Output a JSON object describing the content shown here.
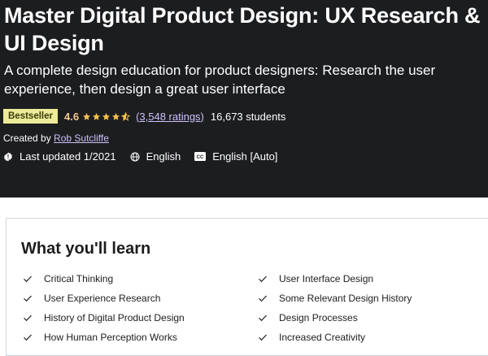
{
  "course": {
    "title": "Master Digital Product Design: UX Research & UI Design",
    "subtitle": "A complete design education for product designers: Research the user experience, then design a great user interface",
    "badge": "Bestseller",
    "rating": "4.6",
    "stars_filled_fraction": 0.92,
    "ratings_count": "(3,548 ratings)",
    "students": "16,673 students",
    "created_by_label": "Created by",
    "author": "Rob Sutcliffe",
    "last_updated": "Last updated 1/2021",
    "language": "English",
    "captions": "English [Auto]"
  },
  "learn": {
    "heading": "What you'll learn",
    "items": [
      "Critical Thinking",
      "User Interface Design",
      "User Experience Research",
      "Some Relevant Design History",
      "History of Digital Product Design",
      "Design Processes",
      "How Human Perception Works",
      "Increased Creativity"
    ]
  },
  "icons": {
    "updated": "alert-badge-icon",
    "language": "globe-icon",
    "captions": "closed-captions-icon",
    "check": "check-icon",
    "star": "star-icon"
  },
  "colors": {
    "hero_bg": "#1c1d1f",
    "badge_bg": "#eceb98",
    "rating": "#f3ca8c",
    "link": "#cec0fc",
    "stars": "#f4c150"
  }
}
